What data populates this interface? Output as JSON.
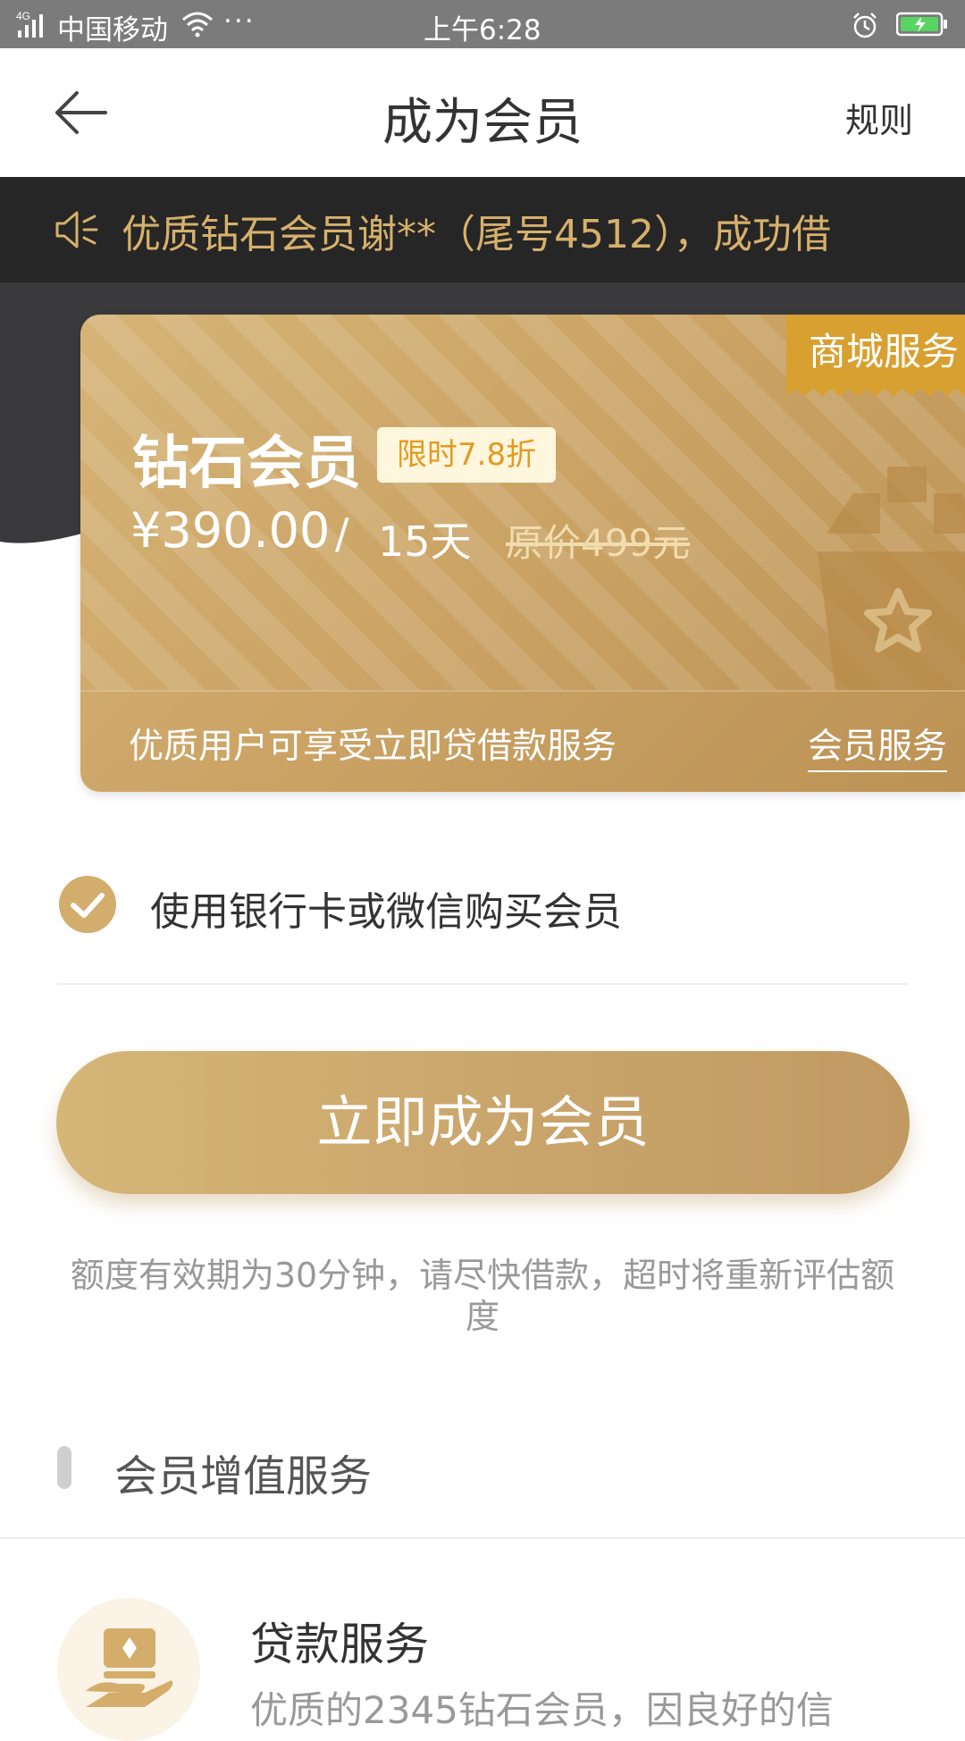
{
  "status_bar": {
    "signal": "4G",
    "carrier": "中国移动",
    "more": "···",
    "time": "上午6:28",
    "icons": [
      "signal-icon",
      "wifi-icon",
      "alarm-icon",
      "battery-icon"
    ]
  },
  "nav": {
    "title": "成为会员",
    "rules": "规则",
    "back_icon": "back-arrow-icon"
  },
  "notice": {
    "text": "优质钻石会员谢**（尾号4512），成功借",
    "icon": "speaker-icon"
  },
  "card": {
    "ribbon": "商城服务",
    "tier": "钻石会员",
    "discount_badge": "限时7.8折",
    "price": "¥390.00",
    "separator": "/",
    "period": "15天",
    "original_price": "原价499元",
    "benefit": "优质用户可享受立即贷借款服务",
    "agreement_link": "会员服务",
    "icon": "shopping-bag-star-icon"
  },
  "payment": {
    "option_label": "使用银行卡或微信购买会员",
    "checked": true
  },
  "cta": {
    "label": "立即成为会员"
  },
  "tip": {
    "text": "额度有效期为30分钟，请尽快借款，超时将重新评估额度"
  },
  "section": {
    "title": "会员增值服务"
  },
  "services": [
    {
      "title": "贷款服务",
      "desc": "优质的2345钻石会员，因良好的信",
      "icon": "loan-hand-icon"
    }
  ],
  "colors": {
    "gold": "#c9a56b",
    "notice_bg": "#262626",
    "notice_text": "#d6b06b",
    "ribbon": "#d8a030",
    "badge_text": "#e49a1f"
  }
}
